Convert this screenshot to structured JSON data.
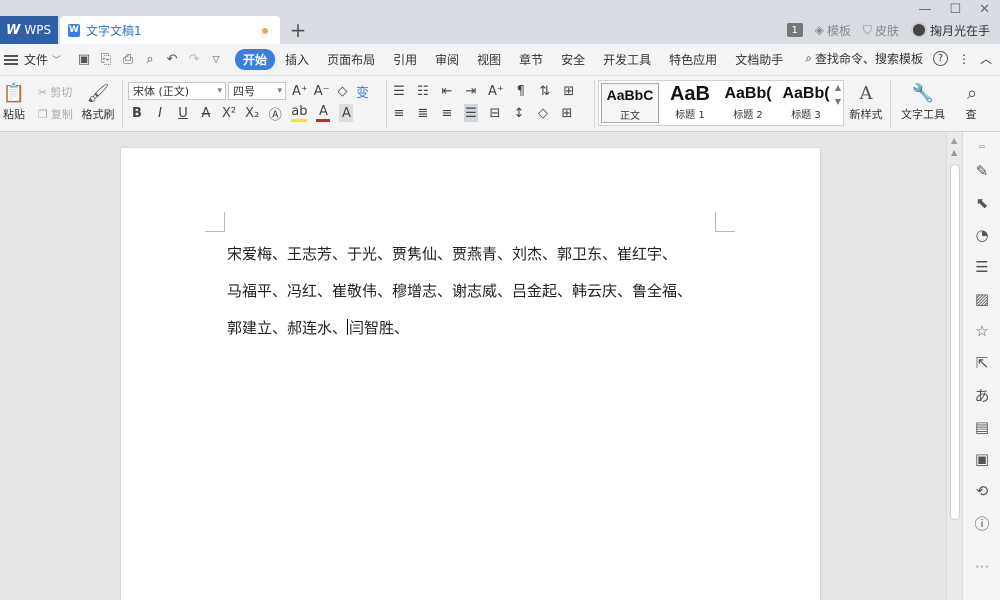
{
  "titlebar": {
    "app_tab": "WPS",
    "doc_tab": "文字文稿1",
    "template_label": "模板",
    "skin_label": "皮肤",
    "page_count": "1",
    "user_name": "掬月光在手"
  },
  "menubar": {
    "file_label": "文件",
    "items": [
      "开始",
      "插入",
      "页面布局",
      "引用",
      "审阅",
      "视图",
      "章节",
      "安全",
      "开发工具",
      "特色应用",
      "文档助手"
    ],
    "active_index": 0,
    "search_label": "查找命令、搜索模板"
  },
  "ribbon": {
    "paste": "粘贴",
    "cut": "剪切",
    "copy": "复制",
    "format_painter": "格式刷",
    "font_name": "宋体 (正文)",
    "font_size": "四号",
    "styles": [
      {
        "sample": "AaBbC",
        "name": "正文"
      },
      {
        "sample": "AaB",
        "name": "标题 1"
      },
      {
        "sample": "AaBb(",
        "name": "标题 2"
      },
      {
        "sample": "AaBb(",
        "name": "标题 3"
      }
    ],
    "new_style": "新样式",
    "text_tools": "文字工具",
    "find_cut": "查"
  },
  "document": {
    "lines": [
      "宋爱梅、王志芳、于光、贾隽仙、贾燕青、刘杰、郭卫东、崔红宇、",
      "马福平、冯红、崔敬伟、穆增志、谢志威、吕金起、韩云庆、鲁全福、"
    ],
    "line3_before_caret": "郭建立、郝连水、",
    "line3_after_caret": "闫智胜、"
  },
  "colors": {
    "accent": "#3a7ee0",
    "wps_blue": "#2f5fa8"
  }
}
